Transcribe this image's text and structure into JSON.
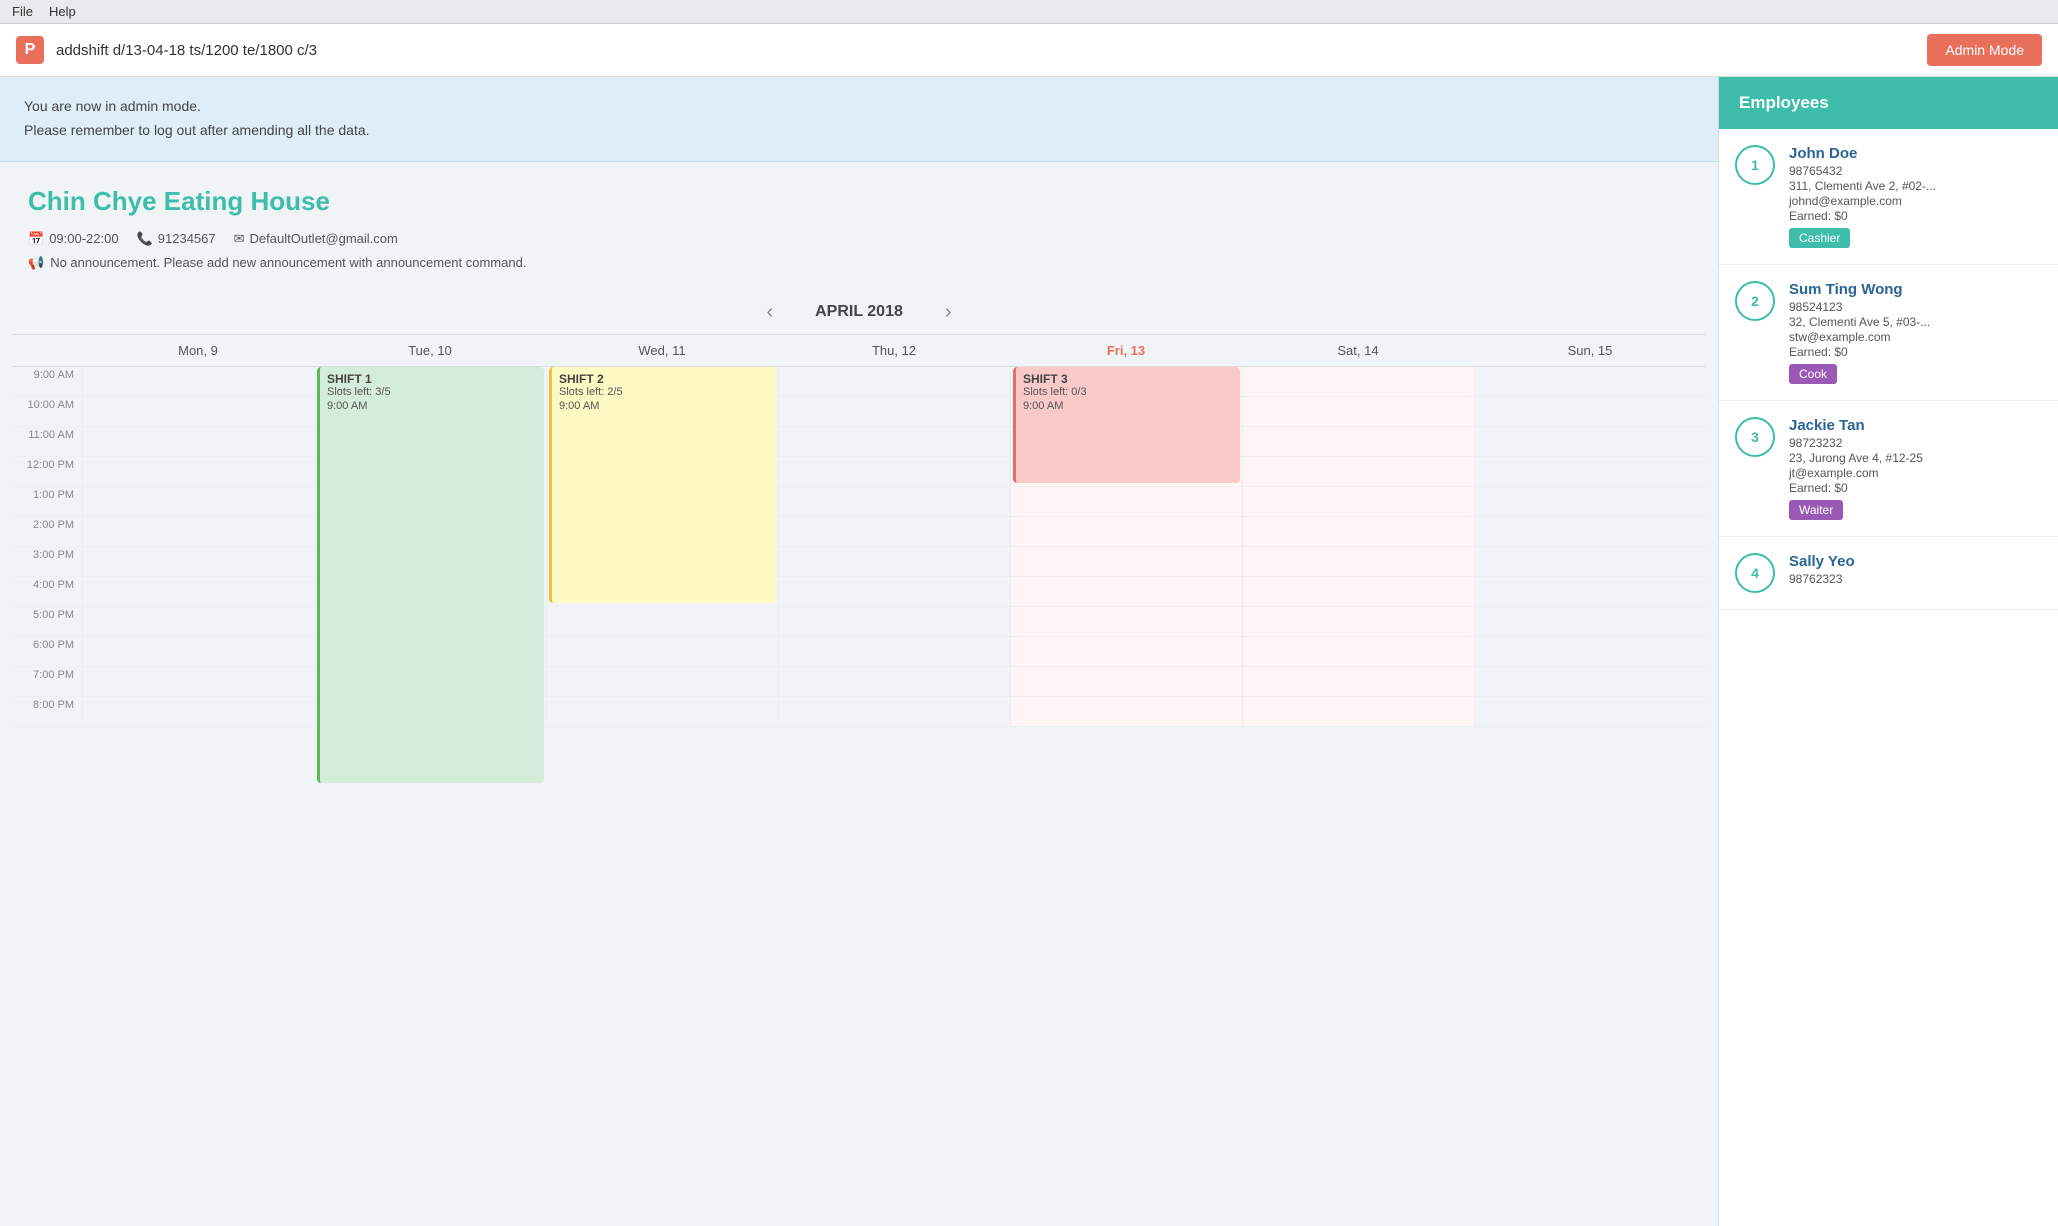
{
  "menu": {
    "file": "File",
    "help": "Help"
  },
  "command_bar": {
    "logo": "P",
    "input_value": "addshift d/13-04-18 ts/1200 te/1800 c/3",
    "admin_mode_label": "Admin Mode"
  },
  "admin_notice": {
    "line1": "You are now in admin mode.",
    "line2": "Please remember to log out after amending all the data."
  },
  "outlet": {
    "name": "Chin Chye Eating House",
    "hours": "09:00-22:00",
    "phone": "91234567",
    "email": "DefaultOutlet@gmail.com",
    "announcement": "No announcement. Please add new announcement with announcement command."
  },
  "calendar": {
    "month_year": "APRIL 2018",
    "days": [
      {
        "label": "Mon, 9",
        "today": false,
        "col": "mon"
      },
      {
        "label": "Tue, 10",
        "today": false,
        "col": "tue"
      },
      {
        "label": "Wed, 11",
        "today": false,
        "col": "wed"
      },
      {
        "label": "Thu, 12",
        "today": false,
        "col": "thu"
      },
      {
        "label": "Fri, 13",
        "today": true,
        "col": "fri"
      },
      {
        "label": "Sat, 14",
        "today": false,
        "col": "sat"
      },
      {
        "label": "Sun, 15",
        "today": false,
        "col": "sun"
      }
    ],
    "time_slots": [
      "9:00 AM",
      "10:00 AM",
      "11:00 AM",
      "12:00 PM",
      "1:00 PM",
      "2:00 PM",
      "3:00 PM",
      "4:00 PM",
      "5:00 PM",
      "6:00 PM",
      "7:00 PM",
      "8:00 PM"
    ],
    "shifts": [
      {
        "id": "shift1",
        "title": "SHIFT 1",
        "slots": "Slots left: 3/5",
        "time": "9:00 AM",
        "col": 2,
        "color": "green",
        "start_row": 0,
        "span_rows": 14
      },
      {
        "id": "shift2",
        "title": "SHIFT 2",
        "slots": "Slots left: 2/5",
        "time": "9:00 AM",
        "col": 3,
        "color": "yellow",
        "start_row": 0,
        "span_rows": 8
      },
      {
        "id": "shift3",
        "title": "SHIFT 3",
        "slots": "Slots left: 0/3",
        "time": "9:00 AM",
        "col": 5,
        "color": "red",
        "start_row": 0,
        "span_rows": 4
      }
    ]
  },
  "employees_header": "Employees",
  "employees": [
    {
      "number": "1",
      "name": "John Doe",
      "phone": "98765432",
      "address": "311, Clementi Ave 2, #02-...",
      "email": "johnd@example.com",
      "earned": "Earned: $0",
      "role": "Cashier",
      "badge_class": "badge-cashier"
    },
    {
      "number": "2",
      "name": "Sum Ting Wong",
      "phone": "98524123",
      "address": "32, Clementi Ave 5, #03-...",
      "email": "stw@example.com",
      "earned": "Earned: $0",
      "role": "Cook",
      "badge_class": "badge-cook"
    },
    {
      "number": "3",
      "name": "Jackie Tan",
      "phone": "98723232",
      "address": "23, Jurong Ave 4, #12-25",
      "email": "jt@example.com",
      "earned": "Earned: $0",
      "role": "Waiter",
      "badge_class": "badge-waiter"
    },
    {
      "number": "4",
      "name": "Sally Yeo",
      "phone": "98762323",
      "address": "",
      "email": "",
      "earned": "",
      "role": "",
      "badge_class": ""
    }
  ]
}
